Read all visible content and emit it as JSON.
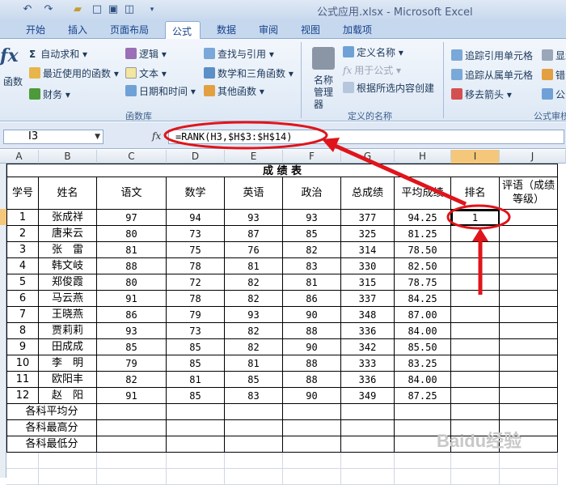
{
  "window": {
    "title": "公式应用.xlsx - Microsoft Excel"
  },
  "tabs": [
    "开始",
    "插入",
    "页面布局",
    "公式",
    "数据",
    "审阅",
    "视图",
    "加载项"
  ],
  "ribbon": {
    "insert_function": "函数",
    "autosum": "自动求和 ▾",
    "recent": "最近使用的函数 ▾",
    "finance": "财务 ▾",
    "logic": "逻辑 ▾",
    "text": "文本 ▾",
    "datetime": "日期和时间 ▾",
    "lookup": "查找与引用 ▾",
    "math": "数学和三角函数 ▾",
    "other": "其他函数 ▾",
    "name_manager": "名称管理器",
    "define_name": "定义名称 ▾",
    "use_in_formula": "用于公式 ▾",
    "create_from_selection": "根据所选内容创建",
    "trace_precedents": "追踪引用单元格",
    "trace_dependents": "追踪从属单元格",
    "remove_arrows": "移去箭头 ▾",
    "show_formulas": "显示",
    "error_check": "错",
    "evaluate": "公",
    "group_library": "函数库",
    "group_names": "定义的名称",
    "group_audit": "公式审核"
  },
  "name_box": "I3",
  "formula": "=RANK(H3,$H$3:$H$14)",
  "columns": [
    "A",
    "B",
    "C",
    "D",
    "E",
    "F",
    "G",
    "H",
    "I",
    "J"
  ],
  "sheet": {
    "title": "成 绩 表",
    "headers": [
      "学号",
      "姓名",
      "语文",
      "数学",
      "英语",
      "政治",
      "总成绩",
      "平均成绩",
      "排名",
      "评语（成绩等级）"
    ],
    "rows": [
      [
        "1",
        "张成祥",
        "97",
        "94",
        "93",
        "93",
        "377",
        "94.25",
        "1"
      ],
      [
        "2",
        "唐来云",
        "80",
        "73",
        "87",
        "85",
        "325",
        "81.25",
        ""
      ],
      [
        "3",
        "张　雷",
        "81",
        "75",
        "76",
        "82",
        "314",
        "78.50",
        ""
      ],
      [
        "4",
        "韩文岐",
        "88",
        "78",
        "81",
        "83",
        "330",
        "82.50",
        ""
      ],
      [
        "5",
        "郑俊霞",
        "80",
        "72",
        "82",
        "81",
        "315",
        "78.75",
        ""
      ],
      [
        "6",
        "马云燕",
        "91",
        "78",
        "82",
        "86",
        "337",
        "84.25",
        ""
      ],
      [
        "7",
        "王晓燕",
        "86",
        "79",
        "93",
        "90",
        "348",
        "87.00",
        ""
      ],
      [
        "8",
        "贾莉莉",
        "93",
        "73",
        "82",
        "88",
        "336",
        "84.00",
        ""
      ],
      [
        "9",
        "田成成",
        "85",
        "85",
        "82",
        "90",
        "342",
        "85.50",
        ""
      ],
      [
        "10",
        "李　明",
        "79",
        "85",
        "81",
        "88",
        "333",
        "83.25",
        ""
      ],
      [
        "11",
        "欧阳丰",
        "82",
        "81",
        "85",
        "88",
        "336",
        "84.00",
        ""
      ],
      [
        "12",
        "赵　阳",
        "91",
        "85",
        "83",
        "90",
        "349",
        "87.25",
        ""
      ]
    ],
    "summary_rows": [
      "各科平均分",
      "各科最高分",
      "各科最低分"
    ]
  },
  "watermark": "Baidu经验",
  "colors": {
    "annotation_red": "#e0141b",
    "ribbon_blue": "#15428b"
  }
}
